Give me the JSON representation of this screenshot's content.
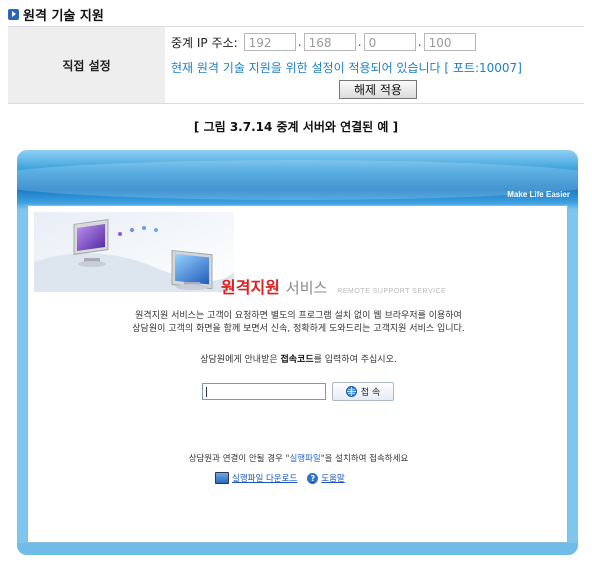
{
  "section": {
    "title": "원격 기술 지원"
  },
  "settings": {
    "row_label": "직접 설정",
    "relay_ip_label": "중계 IP 주소:",
    "ip": [
      "192",
      "168",
      "0",
      "100"
    ],
    "notice": "현재 원격 기술 지원을 위한 설정이 적용되어 있습니다 [ 포트:10007]",
    "release_button": "해제 적용"
  },
  "figure": {
    "caption": "[ 그림 3.7.14  중계 서버와 연결된 예  ]"
  },
  "service_page": {
    "tagline": "Make Life Easier",
    "title_red": "원격지원",
    "title_gray": "서비스",
    "title_eng": "REMOTE SUPPORT SERVICE",
    "desc_line1": "원격지원 서비스는 고객이 요청하면 별도의 프로그램 설치 없이 웹 브라우저를 이용하여",
    "desc_line2": "상담원이 고객의 화면을 함께 보면서 신속, 정확하게 도와드리는 고객지원 서비스 입니다.",
    "prompt_before": "상담원에게 안내받은 ",
    "prompt_bold": "접속코드",
    "prompt_after": "를 입력하여 주십시오.",
    "connect_button": "접 속",
    "guide_before": "상담원과 연결이 안될 경우 \"",
    "guide_link": "실행파일",
    "guide_after": "\"을 설치하여 접속하세요",
    "download_link": "실행파일 다운로드",
    "help_link": "도움말",
    "colors": {
      "accent_red": "#e02020",
      "link_blue": "#1a55c0",
      "notice_blue": "#1e7fc9"
    }
  }
}
